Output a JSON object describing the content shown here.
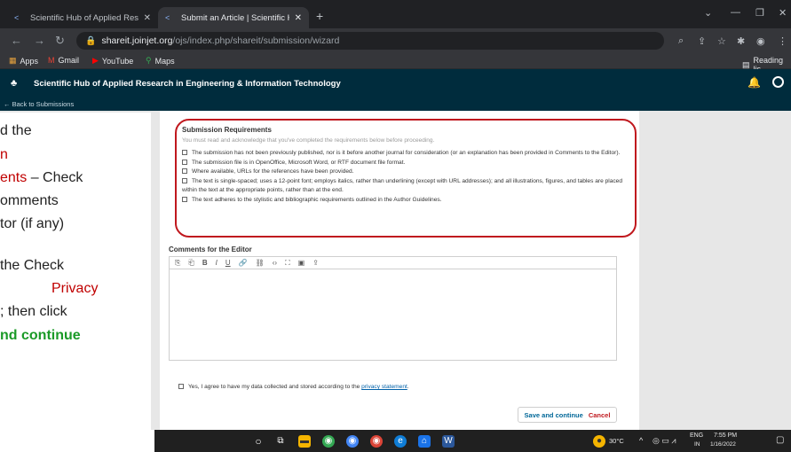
{
  "browser": {
    "tabs": [
      {
        "label": "Scientific Hub of Applied Researc",
        "close": "✕"
      },
      {
        "label": "Submit an Article | Scientific Hub",
        "close": "✕"
      }
    ],
    "new_tab": "+",
    "url_host": "shareit.joinjet.org",
    "url_path": "/ojs/index.php/shareit/submission/wizard",
    "bookmarks": [
      "Apps",
      "Gmail",
      "YouTube",
      "Maps"
    ],
    "reading_list": "Reading lis"
  },
  "header": {
    "site_title": "Scientific Hub of Applied Research in Engineering & Information Technology",
    "back_link": "← Back to Submissions"
  },
  "requirements": {
    "title": "Submission Requirements",
    "subtitle": "You must read and acknowledge that you've completed the requirements below before proceeding.",
    "items": [
      "The submission has not been previously published, nor is it before another journal for consideration (or an explanation has been provided in Comments to the Editor).",
      "The submission file is in OpenOffice, Microsoft Word, or RTF document file format.",
      "Where available, URLs for the references have been provided.",
      "The text is single-spaced; uses a 12-point font; employs italics, rather than underlining (except with URL addresses); and all illustrations, figures, and tables are placed within the text at the appropriate points, rather than at the end.",
      "The text adheres to the stylistic and bibliographic requirements outlined in the Author Guidelines."
    ]
  },
  "comments": {
    "title": "Comments for the Editor",
    "toolbar": [
      "⎘",
      "⎗",
      "B",
      "I",
      "U",
      "🔗",
      "⛓",
      "‹›",
      "⛶",
      "▣",
      "⇪"
    ]
  },
  "agreement": {
    "text": "Yes, I agree to have my data collected and stored according to the",
    "link": "privacy statement",
    "end": "."
  },
  "actions": {
    "save": "Save and continue",
    "cancel": "Cancel"
  },
  "overlay": {
    "lines": [
      {
        "text": "d the",
        "cls": ""
      },
      {
        "text": "n",
        "cls": "red"
      },
      {
        "text_red": "ents",
        "text": " – Check",
        "cls": "mixed"
      },
      {
        "text": "omments",
        "cls": ""
      },
      {
        "text": "tor (if any)",
        "cls": ""
      },
      {
        "text": " the Check",
        "cls": ""
      },
      {
        "text": "Privacy",
        "cls": "red"
      },
      {
        "text": "; then click",
        "cls": ""
      },
      {
        "text": "nd continue",
        "cls": "green"
      }
    ]
  },
  "taskbar": {
    "weather": "30°C",
    "lang_top": "ENG",
    "lang_bottom": "IN",
    "time": "7:55 PM",
    "date": "1/16/2022"
  },
  "colors": {
    "header_bg": "#002c3d",
    "highlight_red": "#c0181e",
    "link_blue": "#0060a8",
    "save_blue": "#006798"
  }
}
